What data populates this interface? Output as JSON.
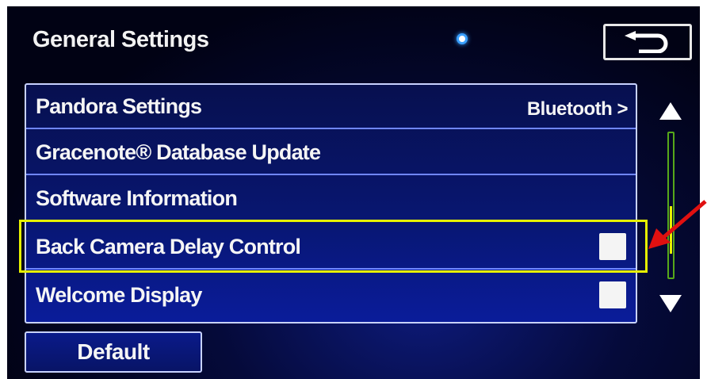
{
  "header": {
    "title": "General Settings",
    "back_icon": "return-arrow-icon"
  },
  "list": {
    "rows": [
      {
        "label": "Pandora Settings",
        "value": "Bluetooth >"
      },
      {
        "label": "Gracenote® Database Update",
        "value": ""
      },
      {
        "label": "Software Information",
        "value": ""
      },
      {
        "label": "Back Camera Delay Control",
        "checkbox_checked": false
      },
      {
        "label": "Welcome Display",
        "checkbox_checked": false
      }
    ],
    "highlighted_row": "Back Camera Delay Control"
  },
  "scrollbar": {
    "up_icon": "triangle-up-icon",
    "down_icon": "triangle-down-icon",
    "position_fraction": 0.75
  },
  "footer": {
    "default_label": "Default"
  },
  "annotation": {
    "highlight_color": "#e6f000",
    "arrow_color": "#e01010"
  }
}
